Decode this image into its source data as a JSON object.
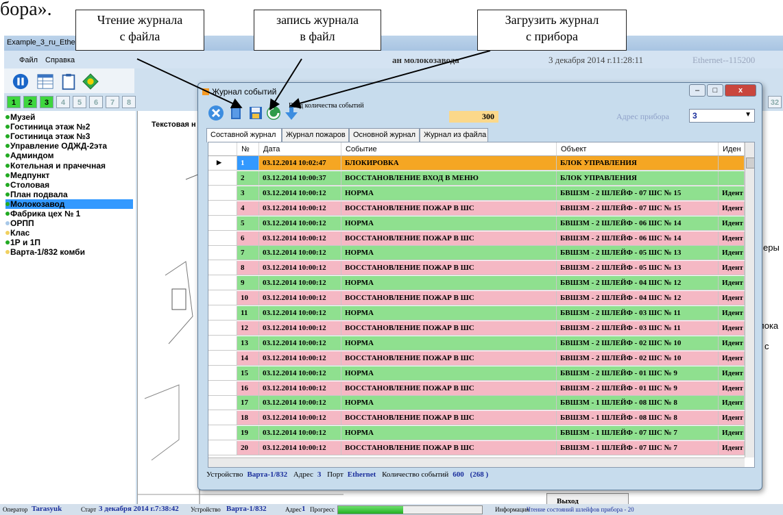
{
  "doc_fragment": "бора».",
  "callouts": {
    "read_from_file": "Чтение журнала\nс файла",
    "write_to_file": "запись журнала\nв файл",
    "load_from_device": "Загрузить журнал\nс прибора"
  },
  "main_window": {
    "title": "Example_3_ru_Ethe",
    "menu": [
      "Файл",
      "Справка"
    ],
    "header_fragment": "ан молокозавода",
    "date_time": "3 декабря 2014 г.11:28:11",
    "connection": "Ethernet--115200",
    "number_tabs": [
      "1",
      "2",
      "3",
      "4",
      "5",
      "6",
      "7",
      "8"
    ],
    "number_tab_right": "32",
    "objects": [
      {
        "label": "Музей",
        "dot": "#22aa22"
      },
      {
        "label": "Гостиница этаж №2",
        "dot": "#22aa22"
      },
      {
        "label": "Гостиница этаж №3",
        "dot": "#22aa22"
      },
      {
        "label": "Управление ОДЖД-2эта",
        "dot": "#22aa22"
      },
      {
        "label": "Админдом",
        "dot": "#22aa22"
      },
      {
        "label": "Котельная и прачечная",
        "dot": "#22aa22"
      },
      {
        "label": "Медпункт",
        "dot": "#22aa22"
      },
      {
        "label": "Столовая",
        "dot": "#22aa22"
      },
      {
        "label": "План подвала",
        "dot": "#22aa22"
      },
      {
        "label": "Молокозавод",
        "dot": "#22aa22",
        "selected": true
      },
      {
        "label": "Фабрика цех № 1",
        "dot": "#22aa22"
      },
      {
        "label": "ОРПП",
        "dot": "#a8c8e8"
      },
      {
        "label": "Клас",
        "dot": "#f0d060"
      },
      {
        "label": "1Р и 1П",
        "dot": "#22aa22"
      },
      {
        "label": "Варта-1/832 комби",
        "dot": "#f0d060"
      }
    ],
    "plan_label": "Текстовая н",
    "plan_right_fragments": [
      "еры",
      "лока",
      "с"
    ],
    "exit_label": "Выход"
  },
  "journal": {
    "title": "Журнал событий",
    "count_label": "Ввод количества событий",
    "count_value": "300",
    "addr_label": "Адрес прибора",
    "addr_value": "3",
    "tabs": [
      "Составной журнал",
      "Журнал пожаров",
      "Основной журнал",
      "Журнал из файла"
    ],
    "columns": {
      "num": "№",
      "date": "Дата",
      "event": "Событие",
      "object": "Объект",
      "id": "Иден"
    },
    "rows": [
      {
        "n": "1",
        "date": "03.12.2014 10:02:47",
        "event": "БЛОКИРОВКА",
        "object": "БЛОК УПРАВЛЕНИЯ",
        "id": "",
        "color": "#f5a623"
      },
      {
        "n": "2",
        "date": "03.12.2014 10:00:37",
        "event": "ВОССТАНОВЛЕНИЕ ВХОД В МЕНЮ",
        "object": "БЛОК УПРАВЛЕНИЯ",
        "id": "",
        "color": "#8fe08f"
      },
      {
        "n": "3",
        "date": "03.12.2014 10:00:12",
        "event": "НОРМА",
        "object": "БВШЗМ - 2 ШЛЕЙФ - 07 ШС № 15",
        "id": "Идент",
        "color": "#8fe08f"
      },
      {
        "n": "4",
        "date": "03.12.2014 10:00:12",
        "event": "ВОССТАНОВЛЕНИЕ ПОЖАР В ШС",
        "object": "БВШЗМ - 2 ШЛЕЙФ - 07 ШС № 15",
        "id": "Идент",
        "color": "#f5b8c4"
      },
      {
        "n": "5",
        "date": "03.12.2014 10:00:12",
        "event": "НОРМА",
        "object": "БВШЗМ - 2 ШЛЕЙФ - 06 ШС № 14",
        "id": "Идент",
        "color": "#8fe08f"
      },
      {
        "n": "6",
        "date": "03.12.2014 10:00:12",
        "event": "ВОССТАНОВЛЕНИЕ ПОЖАР В ШС",
        "object": "БВШЗМ - 2 ШЛЕЙФ - 06 ШС № 14",
        "id": "Идент",
        "color": "#f5b8c4"
      },
      {
        "n": "7",
        "date": "03.12.2014 10:00:12",
        "event": "НОРМА",
        "object": "БВШЗМ - 2 ШЛЕЙФ - 05 ШС № 13",
        "id": "Идент",
        "color": "#8fe08f"
      },
      {
        "n": "8",
        "date": "03.12.2014 10:00:12",
        "event": "ВОССТАНОВЛЕНИЕ ПОЖАР В ШС",
        "object": "БВШЗМ - 2 ШЛЕЙФ - 05 ШС № 13",
        "id": "Идент",
        "color": "#f5b8c4"
      },
      {
        "n": "9",
        "date": "03.12.2014 10:00:12",
        "event": "НОРМА",
        "object": "БВШЗМ - 2 ШЛЕЙФ - 04 ШС № 12",
        "id": "Идент",
        "color": "#8fe08f"
      },
      {
        "n": "10",
        "date": "03.12.2014 10:00:12",
        "event": "ВОССТАНОВЛЕНИЕ ПОЖАР В ШС",
        "object": "БВШЗМ - 2 ШЛЕЙФ - 04 ШС № 12",
        "id": "Идент",
        "color": "#f5b8c4"
      },
      {
        "n": "11",
        "date": "03.12.2014 10:00:12",
        "event": "НОРМА",
        "object": "БВШЗМ - 2 ШЛЕЙФ - 03 ШС № 11",
        "id": "Идент",
        "color": "#8fe08f"
      },
      {
        "n": "12",
        "date": "03.12.2014 10:00:12",
        "event": "ВОССТАНОВЛЕНИЕ ПОЖАР В ШС",
        "object": "БВШЗМ - 2 ШЛЕЙФ - 03 ШС № 11",
        "id": "Идент",
        "color": "#f5b8c4"
      },
      {
        "n": "13",
        "date": "03.12.2014 10:00:12",
        "event": "НОРМА",
        "object": "БВШЗМ - 2 ШЛЕЙФ - 02 ШС № 10",
        "id": "Идент",
        "color": "#8fe08f"
      },
      {
        "n": "14",
        "date": "03.12.2014 10:00:12",
        "event": "ВОССТАНОВЛЕНИЕ ПОЖАР В ШС",
        "object": "БВШЗМ - 2 ШЛЕЙФ - 02 ШС № 10",
        "id": "Идент",
        "color": "#f5b8c4"
      },
      {
        "n": "15",
        "date": "03.12.2014 10:00:12",
        "event": "НОРМА",
        "object": "БВШЗМ - 2 ШЛЕЙФ - 01 ШС № 9",
        "id": "Идент",
        "color": "#8fe08f"
      },
      {
        "n": "16",
        "date": "03.12.2014 10:00:12",
        "event": "ВОССТАНОВЛЕНИЕ ПОЖАР В ШС",
        "object": "БВШЗМ - 2 ШЛЕЙФ - 01 ШС № 9",
        "id": "Идент",
        "color": "#f5b8c4"
      },
      {
        "n": "17",
        "date": "03.12.2014 10:00:12",
        "event": "НОРМА",
        "object": "БВШЗМ - 1 ШЛЕЙФ - 08 ШС № 8",
        "id": "Идент",
        "color": "#8fe08f"
      },
      {
        "n": "18",
        "date": "03.12.2014 10:00:12",
        "event": "ВОССТАНОВЛЕНИЕ ПОЖАР В ШС",
        "object": "БВШЗМ - 1 ШЛЕЙФ - 08 ШС № 8",
        "id": "Идент",
        "color": "#f5b8c4"
      },
      {
        "n": "19",
        "date": "03.12.2014 10:00:12",
        "event": "НОРМА",
        "object": "БВШЗМ - 1 ШЛЕЙФ - 07 ШС № 7",
        "id": "Идент",
        "color": "#8fe08f"
      },
      {
        "n": "20",
        "date": "03.12.2014 10:00:12",
        "event": "ВОССТАНОВЛЕНИЕ ПОЖАР В ШС",
        "object": "БВШЗМ - 1 ШЛЕЙФ - 07 ШС № 7",
        "id": "Идент",
        "color": "#f5b8c4"
      }
    ],
    "status": {
      "device_label": "Устройство",
      "device": "Варта-1/832",
      "addr_label": "Адрес",
      "addr": "3",
      "port_label": "Порт",
      "port": "Ethernet",
      "count_label": "Количество событий",
      "count": "600",
      "extra": "(268 )"
    }
  },
  "statusbar": {
    "operator_label": "Оператор",
    "operator": "Tarasyuk",
    "start_label": "Старт",
    "start": "3 декабря 2014 г.7:38:42",
    "device_label": "Устройство",
    "device": "Варта-1/832",
    "addr_label": "Адрес",
    "addr": "1",
    "progress_label": "Прогресс",
    "progress": 0.45,
    "info_label": "Информация",
    "info": "Чтение состояний шлейфов прибора - 20"
  }
}
